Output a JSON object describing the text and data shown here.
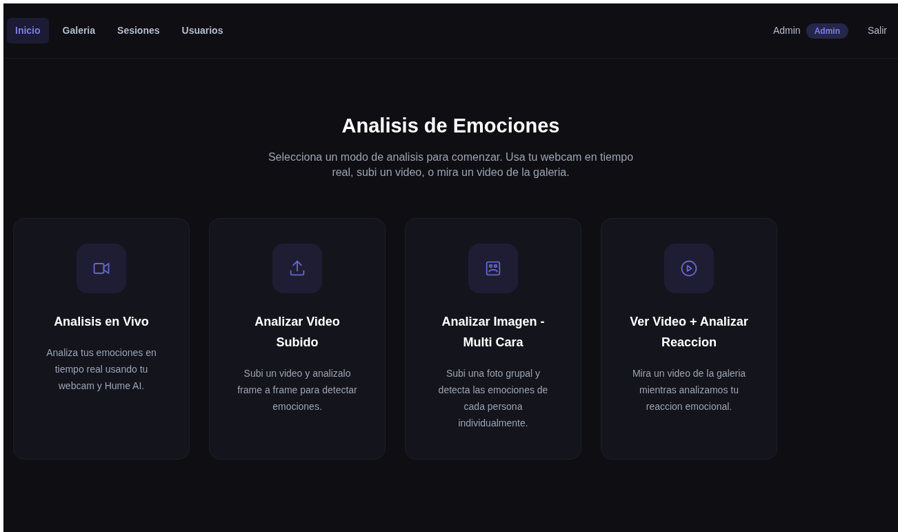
{
  "nav": {
    "items": [
      {
        "label": "Inicio",
        "selected": true
      },
      {
        "label": "Galeria",
        "selected": false
      },
      {
        "label": "Sesiones",
        "selected": false
      },
      {
        "label": "Usuarios",
        "selected": false
      }
    ],
    "user": "Admin",
    "role_badge": "Admin",
    "logout": "Salir"
  },
  "hero": {
    "title": "Analisis de Emociones",
    "subtitle": "Selecciona un modo de analisis para comenzar. Usa tu webcam en tiempo real, subi un video, o mira un video de la galeria."
  },
  "cards": [
    {
      "title": "Analisis en Vivo",
      "description": "Analiza tus emociones en tiempo real usando tu webcam y Hume AI."
    },
    {
      "title": "Analizar Video Subido",
      "description": "Subi un video y analizalo frame a frame para detectar emociones."
    },
    {
      "title": "Analizar Imagen - Multi Cara",
      "description": "Subi una foto grupal y detecta las emociones de cada persona individualmente."
    },
    {
      "title": "Ver Video + Analizar Reaccion",
      "description": "Mira un video de la galeria mientras analizamos tu reaccion emocional."
    }
  ]
}
